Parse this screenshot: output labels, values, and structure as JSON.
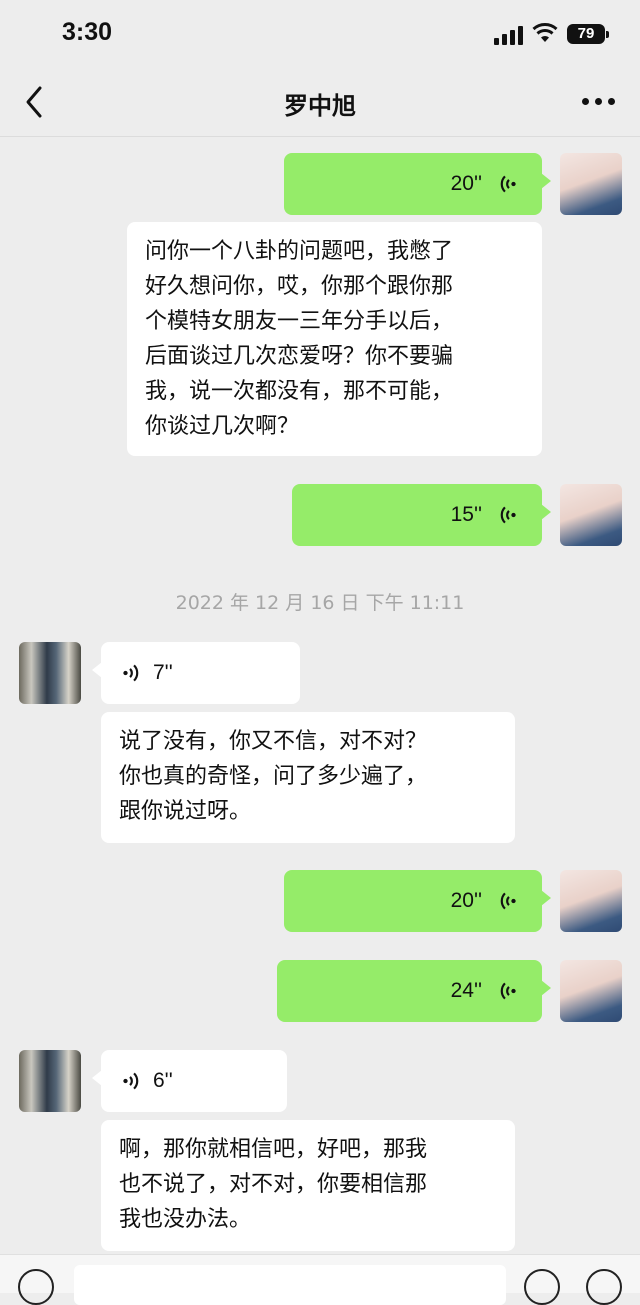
{
  "status": {
    "time": "3:30",
    "battery": "79"
  },
  "nav": {
    "title": "罗中旭"
  },
  "messages": {
    "m1": {
      "duration": "20''"
    },
    "m2": {
      "text": "问你一个八卦的问题吧，我憋了\n好久想问你，哎，你那个跟你那\n个模特女朋友一三年分手以后，\n后面谈过几次恋爱呀？你不要骗\n我，说一次都没有，那不可能，\n你谈过几次啊？"
    },
    "m3": {
      "duration": "15''"
    },
    "timestamp": "2022 年 12 月 16 日  下午 11:11",
    "m4": {
      "duration": "7''"
    },
    "m5": {
      "text": "说了没有，你又不信，对不对？\n你也真的奇怪，问了多少遍了，\n跟你说过呀。"
    },
    "m6": {
      "duration": "20''"
    },
    "m7": {
      "duration": "24''"
    },
    "m8": {
      "duration": "6''"
    },
    "m9": {
      "text": "啊，那你就相信吧，好吧，那我\n也不说了，对不对，你要相信那\n我也没办法。"
    }
  },
  "colors": {
    "outgoing_bubble": "#95ec69",
    "incoming_bubble": "#ffffff",
    "background": "#ededed"
  },
  "icons": [
    "back-chevron-icon",
    "more-dots-icon",
    "voice-wave-icon",
    "voice-input-icon",
    "emoji-icon",
    "plus-icon"
  ]
}
